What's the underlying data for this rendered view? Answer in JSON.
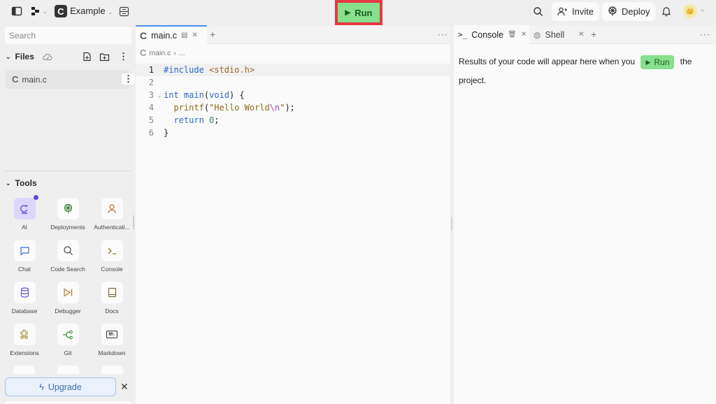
{
  "topbar": {
    "repl_name": "Example",
    "run_label": "Run",
    "invite_label": "Invite",
    "deploy_label": "Deploy",
    "colors": {
      "run_bg": "#86e08c",
      "highlight_outline": "#e63946"
    }
  },
  "sidebar": {
    "search_placeholder": "Search",
    "files_header": "Files",
    "files": [
      {
        "name": "main.c"
      }
    ],
    "tools_header": "Tools",
    "tools": [
      {
        "label": "AI",
        "icon": "ai-icon"
      },
      {
        "label": "Deployments",
        "icon": "deployments-icon"
      },
      {
        "label": "Authenticati...",
        "icon": "user-icon"
      },
      {
        "label": "Chat",
        "icon": "chat-icon"
      },
      {
        "label": "Code Search",
        "icon": "search-icon"
      },
      {
        "label": "Console",
        "icon": "terminal-icon"
      },
      {
        "label": "Database",
        "icon": "database-icon"
      },
      {
        "label": "Debugger",
        "icon": "debugger-icon"
      },
      {
        "label": "Docs",
        "icon": "book-icon"
      },
      {
        "label": "Extensions",
        "icon": "puzzle-icon"
      },
      {
        "label": "Git",
        "icon": "git-icon"
      },
      {
        "label": "Markdown",
        "icon": "markdown-icon"
      }
    ],
    "upgrade_label": "Upgrade"
  },
  "editor": {
    "tab_label": "main.c",
    "breadcrumb": [
      "main.c",
      "..."
    ],
    "lines": [
      {
        "n": "1",
        "text": "#include <stdio.h>"
      },
      {
        "n": "2",
        "text": ""
      },
      {
        "n": "3",
        "text": "int main(void) {"
      },
      {
        "n": "4",
        "text": "  printf(\"Hello World\\n\");"
      },
      {
        "n": "5",
        "text": "  return 0;"
      },
      {
        "n": "6",
        "text": "}"
      }
    ]
  },
  "console": {
    "tab_console": "Console",
    "tab_shell": "Shell",
    "message_before": "Results of your code will appear here when you",
    "run_label": "Run",
    "message_after": "the project."
  }
}
